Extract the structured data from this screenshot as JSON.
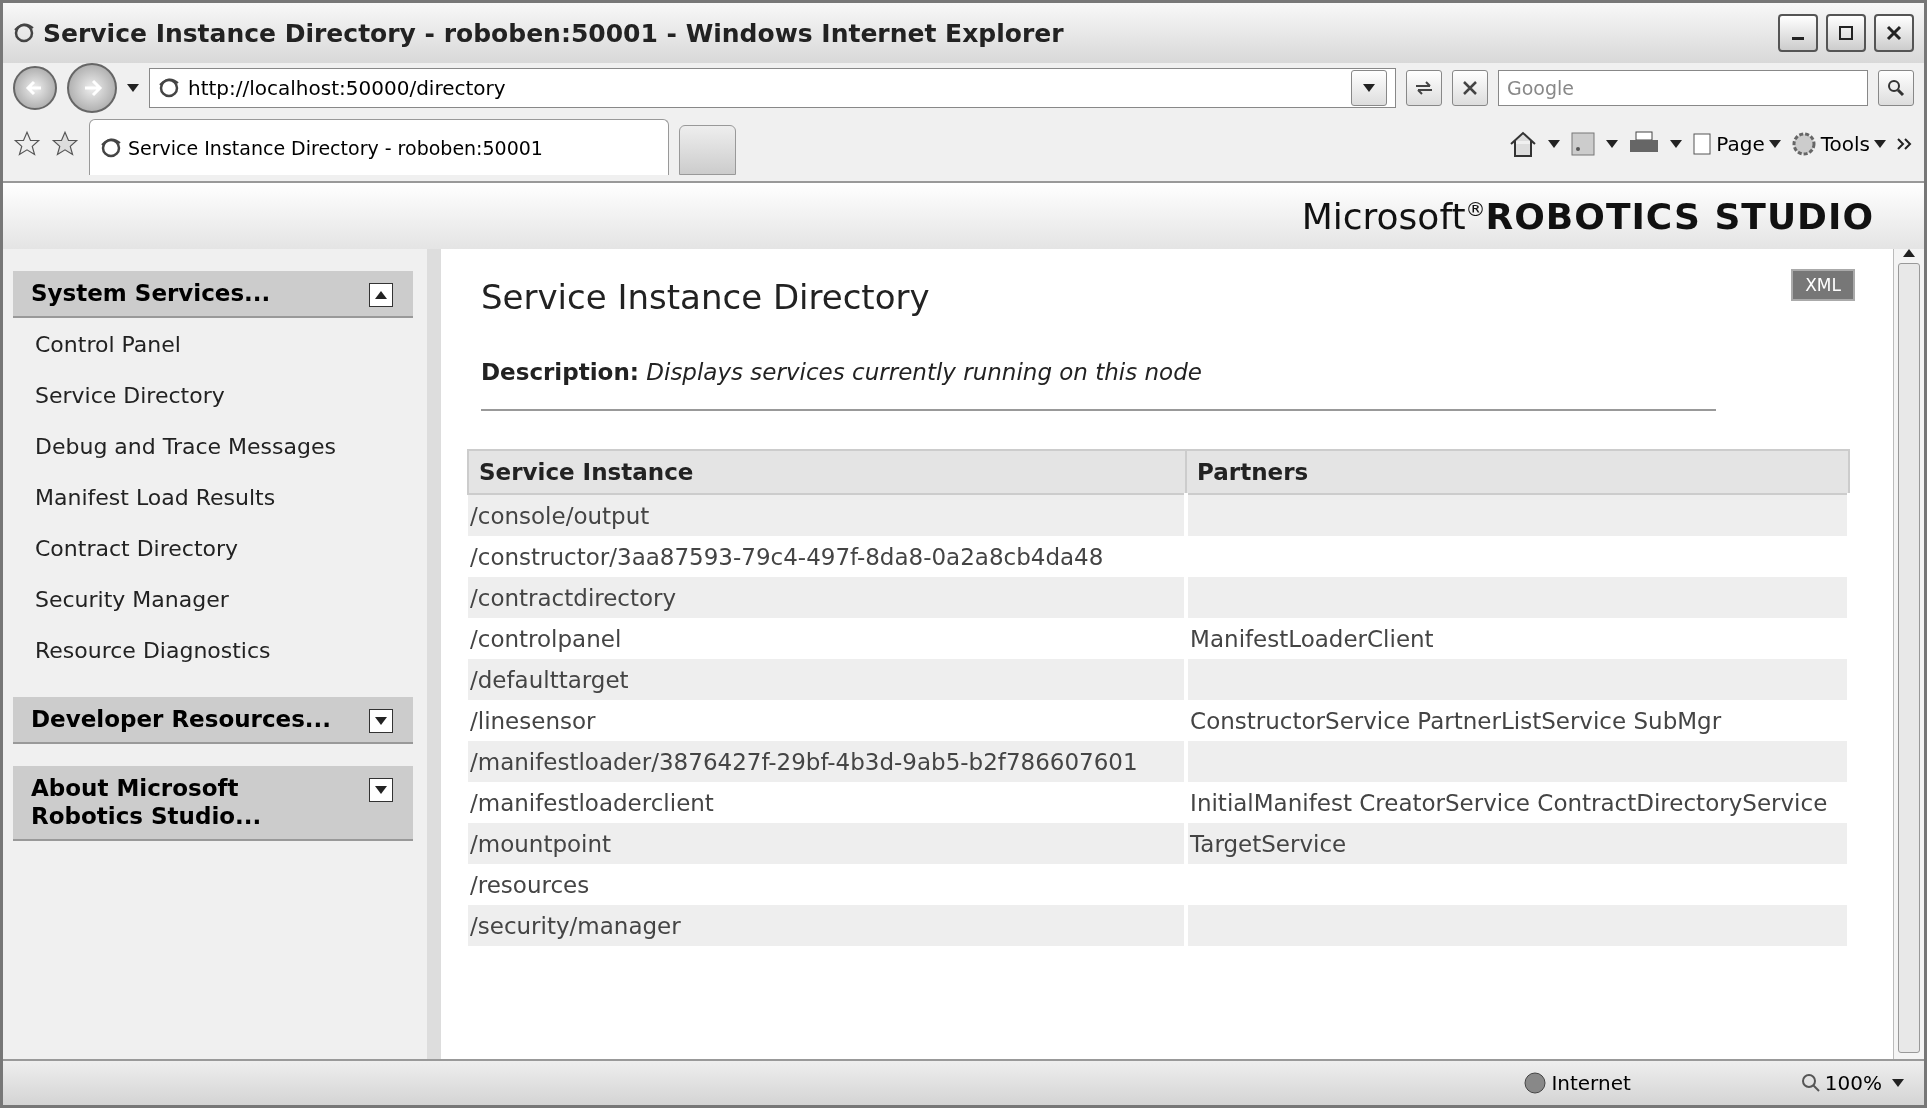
{
  "window": {
    "title": "Service Instance Directory - roboben:50001 - Windows Internet Explorer"
  },
  "address_bar": {
    "url": "http://localhost:50000/directory"
  },
  "search": {
    "placeholder": "Google"
  },
  "tabs": [
    {
      "label": "Service Instance Directory - roboben:50001",
      "selected": true
    }
  ],
  "command_bar": {
    "page": "Page",
    "tools": "Tools"
  },
  "banner": {
    "text": "Microsoft$^{®}$**ROBOTICS STUDIO**"
  },
  "sidebar": {
    "sections": [
      {
        "title": "System Services...",
        "expanded": true,
        "items": [
          "Control Panel",
          "Service Directory",
          "Debug and Trace Messages",
          "Manifest Load Results",
          "Contract Directory",
          "Security Manager",
          "Resource Diagnostics"
        ]
      },
      {
        "title": "Developer Resources...",
        "expanded": false
      },
      {
        "title": "About Microsoft Robotics Studio...",
        "expanded": false
      }
    ]
  },
  "main": {
    "title": "Service Instance Directory",
    "xml_button": "XML",
    "description": "**Description:** *Displays services currently running on this node*",
    "table": {
      "columns": [
        "Service Instance",
        "Partners"
      ],
      "rows": [
        [
          "/console/output",
          ""
        ],
        [
          "/constructor/3aa87593-79c4-497f-8da8-0a2a8cb4da48",
          ""
        ],
        [
          "/contractdirectory",
          ""
        ],
        [
          "/controlpanel",
          "ManifestLoaderClient"
        ],
        [
          "/defaulttarget",
          ""
        ],
        [
          "/linesensor",
          "ConstructorService PartnerListService SubMgr"
        ],
        [
          "/manifestloader/3876427f-29bf-4b3d-9ab5-b2f786607601",
          ""
        ],
        [
          "/manifestloaderclient",
          "InitialManifest CreatorService ContractDirectoryService"
        ],
        [
          "/mountpoint",
          "TargetService"
        ],
        [
          "/resources",
          ""
        ],
        [
          "/security/manager",
          ""
        ]
      ]
    }
  },
  "status_bar": {
    "zone": "Internet",
    "zoom": "100%"
  }
}
